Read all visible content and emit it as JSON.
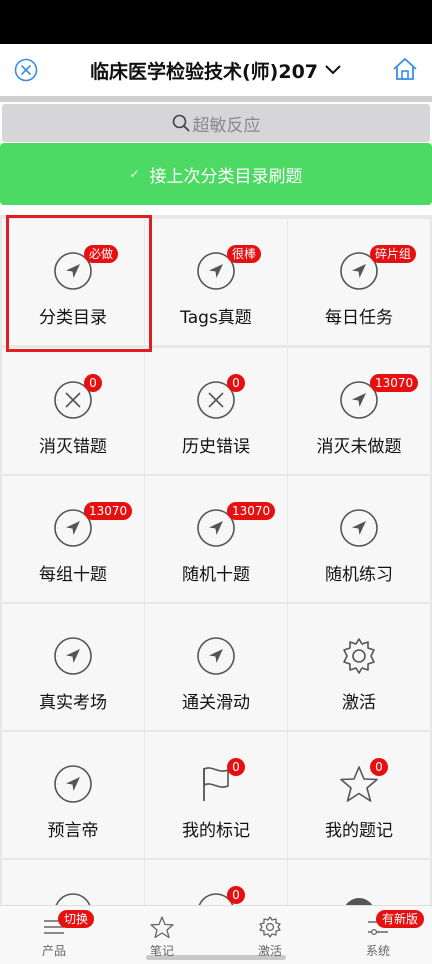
{
  "header": {
    "title": "临床医学检验技术(师)207",
    "close_icon": "close-circle-icon",
    "home_icon": "home-icon",
    "accent": "#3a8ee6"
  },
  "search": {
    "placeholder": "超敏反应"
  },
  "continue_button": {
    "label": "接上次分类目录刷题",
    "color": "#4cd964"
  },
  "grid": {
    "items": [
      {
        "label": "分类目录",
        "icon": "navigation-arrow-icon",
        "badge": "必做"
      },
      {
        "label": "Tags真题",
        "icon": "navigation-arrow-icon",
        "badge": "很棒"
      },
      {
        "label": "每日任务",
        "icon": "navigation-arrow-icon",
        "badge": "碎片组"
      },
      {
        "label": "消灭错题",
        "icon": "x-circle-icon",
        "badge": "0"
      },
      {
        "label": "历史错误",
        "icon": "x-circle-icon",
        "badge": "0"
      },
      {
        "label": "消灭未做题",
        "icon": "navigation-arrow-icon",
        "badge": "13070"
      },
      {
        "label": "每组十题",
        "icon": "navigation-arrow-icon",
        "badge": "13070"
      },
      {
        "label": "随机十题",
        "icon": "navigation-arrow-icon",
        "badge": "13070"
      },
      {
        "label": "随机练习",
        "icon": "navigation-arrow-icon",
        "badge": ""
      },
      {
        "label": "真实考场",
        "icon": "navigation-arrow-icon",
        "badge": ""
      },
      {
        "label": "通关滑动",
        "icon": "navigation-arrow-icon",
        "badge": ""
      },
      {
        "label": "激活",
        "icon": "gear-icon",
        "badge": ""
      },
      {
        "label": "预言帝",
        "icon": "navigation-arrow-icon",
        "badge": ""
      },
      {
        "label": "我的标记",
        "icon": "flag-icon",
        "badge": "0"
      },
      {
        "label": "我的题记",
        "icon": "star-icon",
        "badge": "0"
      },
      {
        "label": "",
        "icon": "navigation-arrow-icon",
        "badge": ""
      },
      {
        "label": "",
        "icon": "navigation-arrow-icon",
        "badge": "0"
      },
      {
        "label": "",
        "icon": "emoji-icon",
        "badge": ""
      }
    ]
  },
  "tabbar": {
    "tabs": [
      {
        "label": "产品",
        "icon": "menu-lines-icon",
        "badge": "切换"
      },
      {
        "label": "笔记",
        "icon": "star-icon",
        "badge": ""
      },
      {
        "label": "激活",
        "icon": "gear-icon",
        "badge": ""
      },
      {
        "label": "系统",
        "icon": "sliders-icon",
        "badge": "有新版"
      }
    ]
  }
}
